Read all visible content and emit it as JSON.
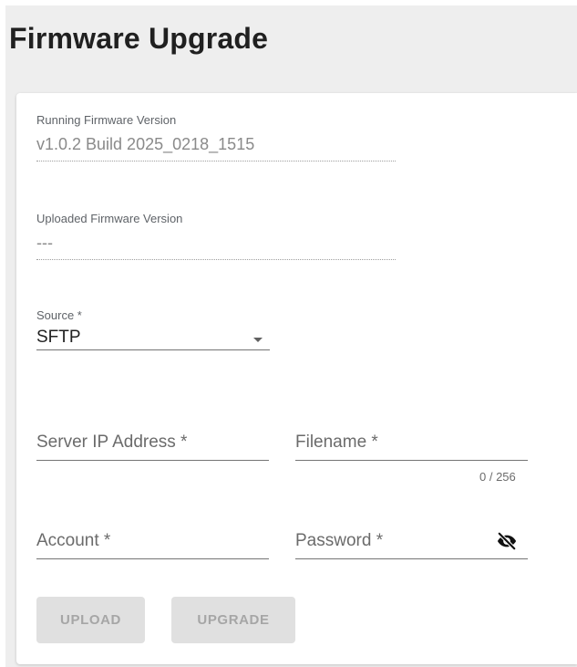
{
  "page": {
    "title": "Firmware Upgrade"
  },
  "running_firmware": {
    "label": "Running Firmware Version",
    "value": "v1.0.2 Build 2025_0218_1515"
  },
  "uploaded_firmware": {
    "label": "Uploaded Firmware Version",
    "value": "---"
  },
  "source": {
    "label": "Source *",
    "value": "SFTP",
    "icon": "chevron-down-icon"
  },
  "server_ip": {
    "placeholder": "Server IP Address *"
  },
  "filename": {
    "placeholder": "Filename *",
    "counter": "0 / 256"
  },
  "account": {
    "placeholder": "Account *"
  },
  "password": {
    "placeholder": "Password *",
    "icon": "eye-off-icon"
  },
  "buttons": {
    "upload": "UPLOAD",
    "upgrade": "UPGRADE"
  },
  "colors": {
    "page_bg": "#eeeeee",
    "button_bg": "#e0e0e0",
    "button_text": "#a6a6a6"
  }
}
